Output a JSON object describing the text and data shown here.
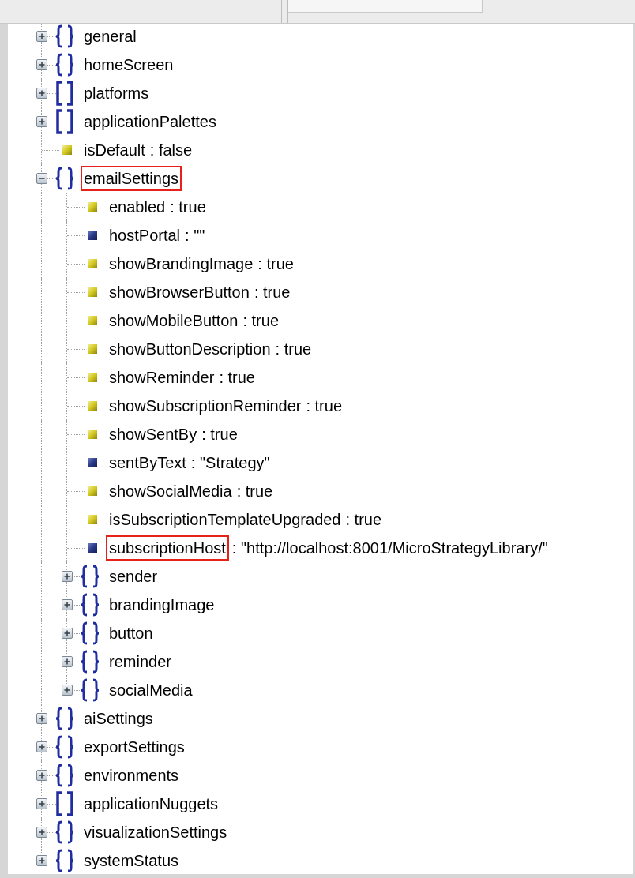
{
  "tree": [
    {
      "name": "general",
      "kind": "object",
      "expanded": false,
      "highlighted": false
    },
    {
      "name": "homeScreen",
      "kind": "object",
      "expanded": false,
      "highlighted": false
    },
    {
      "name": "platforms",
      "kind": "array",
      "expanded": false,
      "highlighted": false
    },
    {
      "name": "applicationPalettes",
      "kind": "array",
      "expanded": false,
      "highlighted": false
    },
    {
      "name": "isDefault",
      "kind": "boolean",
      "value": ": false",
      "highlighted": false
    },
    {
      "name": "emailSettings",
      "kind": "object",
      "expanded": true,
      "highlighted": true,
      "children": [
        {
          "name": "enabled",
          "kind": "boolean",
          "value": ": true",
          "highlighted": false
        },
        {
          "name": "hostPortal",
          "kind": "string",
          "value": ": \"\"",
          "highlighted": false
        },
        {
          "name": "showBrandingImage",
          "kind": "boolean",
          "value": ": true",
          "highlighted": false
        },
        {
          "name": "showBrowserButton",
          "kind": "boolean",
          "value": ": true",
          "highlighted": false
        },
        {
          "name": "showMobileButton",
          "kind": "boolean",
          "value": ": true",
          "highlighted": false
        },
        {
          "name": "showButtonDescription",
          "kind": "boolean",
          "value": ": true",
          "highlighted": false
        },
        {
          "name": "showReminder",
          "kind": "boolean",
          "value": ": true",
          "highlighted": false
        },
        {
          "name": "showSubscriptionReminder",
          "kind": "boolean",
          "value": ": true",
          "highlighted": false
        },
        {
          "name": "showSentBy",
          "kind": "boolean",
          "value": ": true",
          "highlighted": false
        },
        {
          "name": "sentByText",
          "kind": "string",
          "value": ": \"Strategy\"",
          "highlighted": false
        },
        {
          "name": "showSocialMedia",
          "kind": "boolean",
          "value": ": true",
          "highlighted": false
        },
        {
          "name": "isSubscriptionTemplateUpgraded",
          "kind": "boolean",
          "value": ": true",
          "highlighted": false
        },
        {
          "name": "subscriptionHost",
          "kind": "string",
          "value": ": \"http://localhost:8001/MicroStrategyLibrary/\"",
          "highlighted": true
        },
        {
          "name": "sender",
          "kind": "object",
          "expanded": false,
          "highlighted": false
        },
        {
          "name": "brandingImage",
          "kind": "object",
          "expanded": false,
          "highlighted": false
        },
        {
          "name": "button",
          "kind": "object",
          "expanded": false,
          "highlighted": false
        },
        {
          "name": "reminder",
          "kind": "object",
          "expanded": false,
          "highlighted": false
        },
        {
          "name": "socialMedia",
          "kind": "object",
          "expanded": false,
          "highlighted": false
        }
      ]
    },
    {
      "name": "aiSettings",
      "kind": "object",
      "expanded": false,
      "highlighted": false
    },
    {
      "name": "exportSettings",
      "kind": "object",
      "expanded": false,
      "highlighted": false
    },
    {
      "name": "environments",
      "kind": "object",
      "expanded": false,
      "highlighted": false
    },
    {
      "name": "applicationNuggets",
      "kind": "array",
      "expanded": false,
      "highlighted": false
    },
    {
      "name": "visualizationSettings",
      "kind": "object",
      "expanded": false,
      "highlighted": false
    },
    {
      "name": "systemStatus",
      "kind": "object",
      "expanded": false,
      "highlighted": false
    }
  ]
}
